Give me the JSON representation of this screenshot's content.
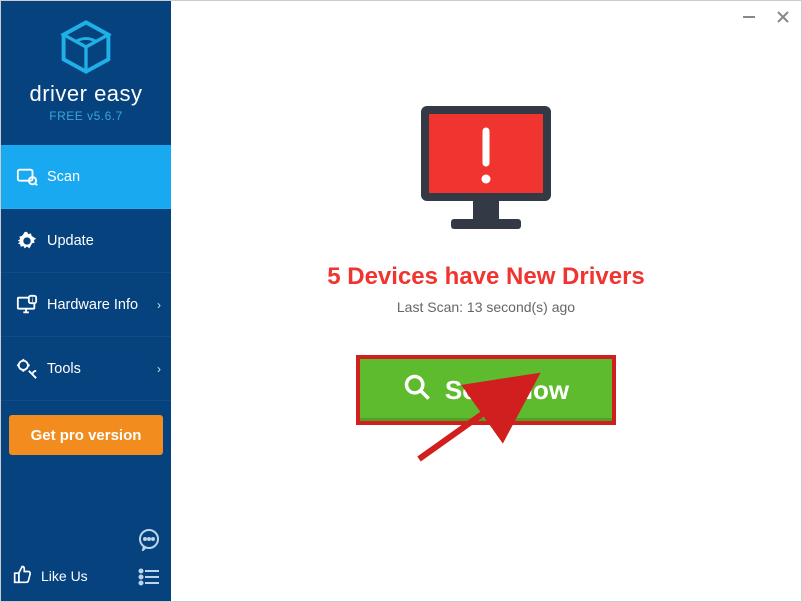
{
  "brand": {
    "name": "driver easy",
    "version_line": "FREE v5.6.7"
  },
  "sidebar": {
    "items": [
      {
        "label": "Scan"
      },
      {
        "label": "Update"
      },
      {
        "label": "Hardware Info"
      },
      {
        "label": "Tools"
      }
    ],
    "pro_label": "Get pro version",
    "like_label": "Like Us"
  },
  "main": {
    "headline": "5 Devices have New Drivers",
    "last_scan": "Last Scan: 13 second(s) ago",
    "scan_button": "Scan Now"
  },
  "colors": {
    "sidebar_bg": "#06427d",
    "active_bg": "#19a9f1",
    "pro_bg": "#f28c1e",
    "headline": "#f0342f",
    "scan_btn_bg": "#5fbb2e",
    "annotation": "#d11f1f"
  }
}
